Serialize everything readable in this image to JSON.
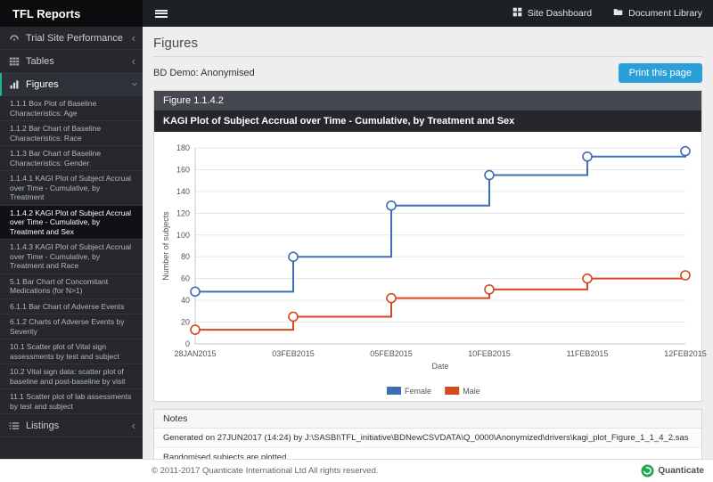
{
  "topbar": {
    "brand": "TFL Reports",
    "links": [
      {
        "label": "Site Dashboard",
        "icon": "dashboard-icon"
      },
      {
        "label": "Document Library",
        "icon": "folder-icon"
      }
    ]
  },
  "sidebar": {
    "sections": [
      {
        "label": "Trial Site Performance",
        "icon": "gauge-icon",
        "expanded": false,
        "active": false
      },
      {
        "label": "Tables",
        "icon": "table-icon",
        "expanded": false,
        "active": false
      },
      {
        "label": "Figures",
        "icon": "chart-icon",
        "expanded": true,
        "active": true
      },
      {
        "label": "Listings",
        "icon": "list-icon",
        "expanded": false,
        "active": false
      }
    ],
    "figures_items": [
      {
        "label": "1.1.1 Box Plot of Baseline Characteristics: Age",
        "active": false
      },
      {
        "label": "1.1.2 Bar Chart of Baseline Characteristics: Race",
        "active": false
      },
      {
        "label": "1.1.3 Bar Chart of Baseline Characteristics: Gender",
        "active": false
      },
      {
        "label": "1.1.4.1 KAGI Plot of Subject Accrual over Time - Cumulative, by Treatment",
        "active": false
      },
      {
        "label": "1.1.4.2 KAGI Plot of Subject Accrual over Time - Cumulative, by Treatment and Sex",
        "active": true
      },
      {
        "label": "1.1.4.3 KAGI Plot of Subject Accrual over Time - Cumulative, by Treatment and Race",
        "active": false
      },
      {
        "label": "5.1 Bar Chart of Concomitant Medications (for N>1)",
        "active": false
      },
      {
        "label": "6.1.1 Bar Chart of Adverse Events",
        "active": false
      },
      {
        "label": "6.1.2 Charts of Adverse Events by Severity",
        "active": false
      },
      {
        "label": "10.1 Scatter plot of Vital sign assessments by test and subject",
        "active": false
      },
      {
        "label": "10.2 Vital sign data: scatter plot of baseline and post-baseline by visit",
        "active": false
      },
      {
        "label": "11.1 Scatter plot of lab assessments by test and subject",
        "active": false
      }
    ]
  },
  "main": {
    "page_title": "Figures",
    "subtitle": "BD Demo: Anonymised",
    "print_button": "Print this page",
    "figure_id": "Figure 1.1.4.2",
    "figure_title": "KAGI Plot of Subject Accrual over Time - Cumulative, by Treatment and Sex",
    "notes": {
      "header": "Notes",
      "rows": [
        "Generated on 27JUN2017 (14:24) by J:\\SASBI\\TFL_initiative\\BDNewCSVDATA\\Q_0000\\Anonymized\\drivers\\kagi_plot_Figure_1_1_4_2.sas",
        "Randomised subjects are plotted."
      ]
    }
  },
  "footer": {
    "copyright": "© 2011-2017 Quanticate International Ltd All rights reserved.",
    "logo_text": "Quanticate"
  },
  "chart_data": {
    "type": "line",
    "subtype": "step",
    "x": [
      "28JAN2015",
      "03FEB2015",
      "05FEB2015",
      "10FEB2015",
      "11FEB2015",
      "12FEB2015"
    ],
    "series": [
      {
        "name": "Female",
        "color": "#3d6eb4",
        "values": [
          48,
          80,
          127,
          155,
          172,
          177
        ]
      },
      {
        "name": "Male",
        "color": "#d44a1e",
        "values": [
          13,
          25,
          42,
          50,
          60,
          63
        ]
      }
    ],
    "xlabel": "Date",
    "ylabel": "Number of subjects",
    "ylim": [
      0,
      180
    ],
    "ytick_step": 20,
    "grid": true,
    "legend_position": "bottom"
  }
}
